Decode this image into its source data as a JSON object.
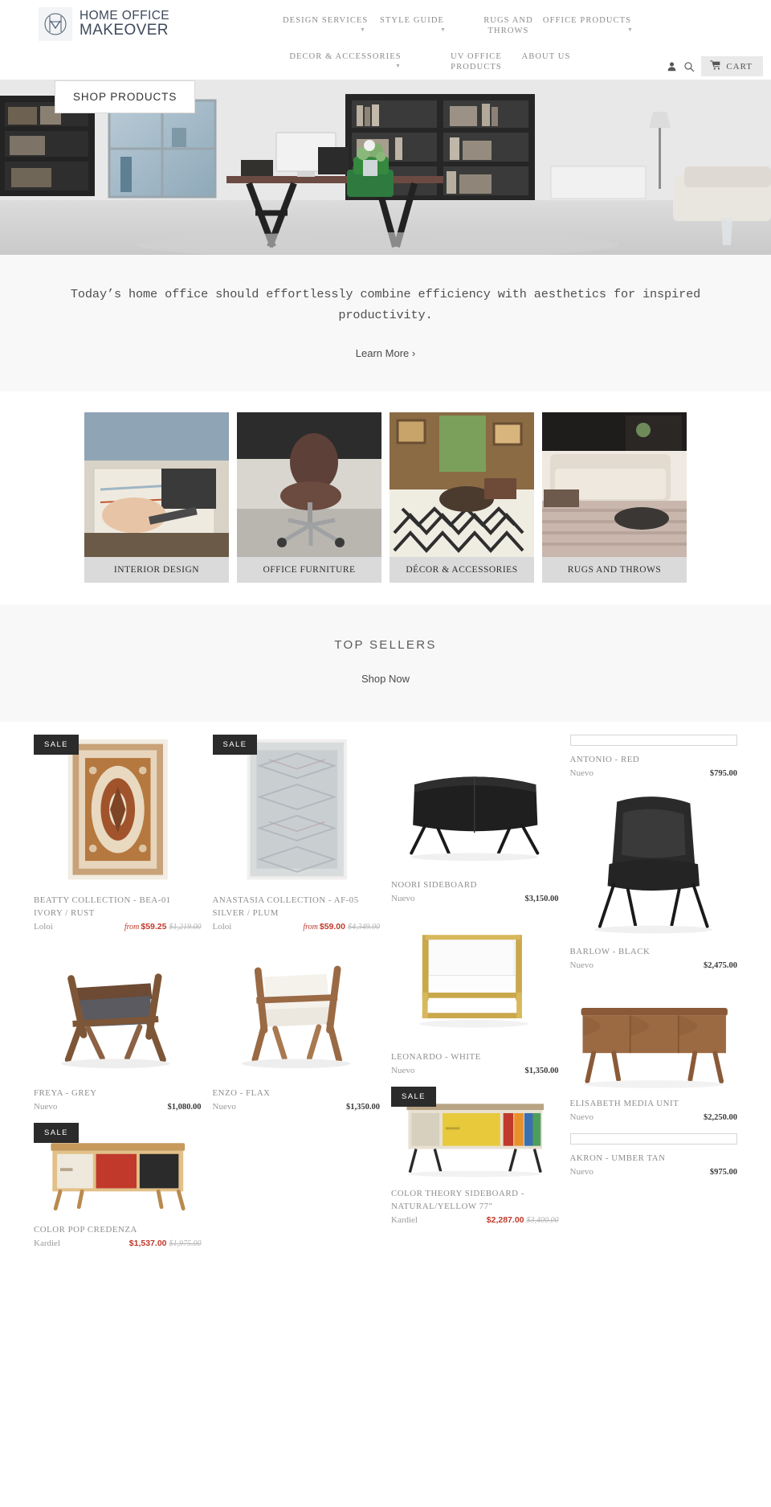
{
  "header": {
    "logo": {
      "line1": "HOME OFFICE",
      "line2": "MAKEOVER",
      "icon": "monogram-logo-icon"
    },
    "nav": [
      {
        "label": "DESIGN SERVICES",
        "caret": "▼"
      },
      {
        "label": "STYLE GUIDE",
        "caret": "▼"
      },
      {
        "label": "RUGS AND THROWS",
        "caret": ""
      },
      {
        "label": "OFFICE PRODUCTS",
        "caret": "▼"
      },
      {
        "label": "DECOR & ACCESSORIES",
        "caret": "▼"
      },
      {
        "label": "UV OFFICE PRODUCTS",
        "caret": ""
      },
      {
        "label": "ABOUT US",
        "caret": ""
      }
    ],
    "account_icon": "user-icon",
    "search_icon": "search-icon",
    "cart": {
      "label": "CART",
      "icon": "shopping-cart-icon"
    }
  },
  "hero": {
    "cta_label": "SHOP PRODUCTS",
    "alt": "modern home office with dark shelving, trestle desk and green chair"
  },
  "tagline": {
    "text": "Today’s home office should effortlessly combine efficiency with aesthetics for inspired productivity.",
    "link_label": "Learn More ›"
  },
  "categories": [
    {
      "label": "INTERIOR DESIGN",
      "alt": "hands sketching on blueprints at a desk"
    },
    {
      "label": "OFFICE FURNITURE",
      "alt": "ergonomic mesh office chair"
    },
    {
      "label": "DÉCOR & ACCESSORIES",
      "alt": "living room with patterned rug and lounge chair"
    },
    {
      "label": "RUGS AND THROWS",
      "alt": "tufted sofa on a distressed area rug"
    }
  ],
  "top_sellers": {
    "title": "TOP SELLERS",
    "shop_now_label": "Shop Now"
  },
  "products": [
    {
      "title": "BEATTY COLLECTION - BEA-01 IVORY / RUST",
      "vendor": "Loloi",
      "from_label": "from",
      "sale_price": "$59.25",
      "compare_price": "$1,219.00",
      "badge": "SALE",
      "alt": "ornate ivory and rust persian area rug",
      "column": 1
    },
    {
      "title": "ANASTASIA COLLECTION - AF-05 SILVER / PLUM",
      "vendor": "Loloi",
      "from_label": "from",
      "sale_price": "$59.00",
      "compare_price": "$4,349.00",
      "badge": "SALE",
      "alt": "distressed silver and plum area rug",
      "column": 2
    },
    {
      "title": "LEONARDO - WHITE",
      "vendor": "Nuevo",
      "price": "$1,350.00",
      "alt": "white leather armchair with gold metal frame",
      "column": 3
    },
    {
      "title": "BARLOW - BLACK",
      "vendor": "Nuevo",
      "price": "$2,475.00",
      "alt": "black high back lounge chair",
      "column": 4
    },
    {
      "title": "FREYA - GREY",
      "vendor": "Nuevo",
      "price": "$1,080.00",
      "alt": "walnut frame lounge chair with grey cushion",
      "column": 1
    },
    {
      "title": "ENZO - FLAX",
      "vendor": "Nuevo",
      "price": "$1,350.00",
      "alt": "walnut armchair with cream flax upholstery",
      "column": 2
    },
    {
      "title": "COLOR THEORY SIDEBOARD - NATURAL/YELLOW 77\"",
      "vendor": "Kardiel",
      "sale_price": "$2,287.00",
      "compare_price": "$3,400.00",
      "badge": "SALE",
      "alt": "mid century sideboard with yellow door and colored drawers",
      "column": 3
    },
    {
      "title": "ELISABETH MEDIA UNIT",
      "vendor": "Nuevo",
      "price": "$2,250.00",
      "alt": "walnut media console with sculpted door fronts",
      "column": 4
    },
    {
      "title": "COLOR POP CREDENZA",
      "vendor": "Kardiel",
      "sale_price": "$1,537.00",
      "compare_price": "$1,975.00",
      "badge": "SALE",
      "alt": "credenza with red and black sliding doors",
      "column": 1
    },
    {
      "title": "NOORI SIDEBOARD",
      "vendor": "Nuevo",
      "price": "$3,150.00",
      "alt": "black curved sideboard on thin metal legs",
      "column": 2
    },
    {
      "title": "ANTONIO - RED",
      "vendor": "Nuevo",
      "price": "$795.00",
      "swatch": true,
      "column": 3
    },
    {
      "title": "AKRON - UMBER TAN",
      "vendor": "Nuevo",
      "price": "$975.00",
      "swatch": true,
      "column": 4
    }
  ],
  "colors": {
    "sale_red": "#c0392b",
    "badge_bg": "#2b2b2b",
    "band_bg": "#f8f8f8",
    "cat_label_bg": "#dadada",
    "logo_navy": "#3d4a5c"
  }
}
